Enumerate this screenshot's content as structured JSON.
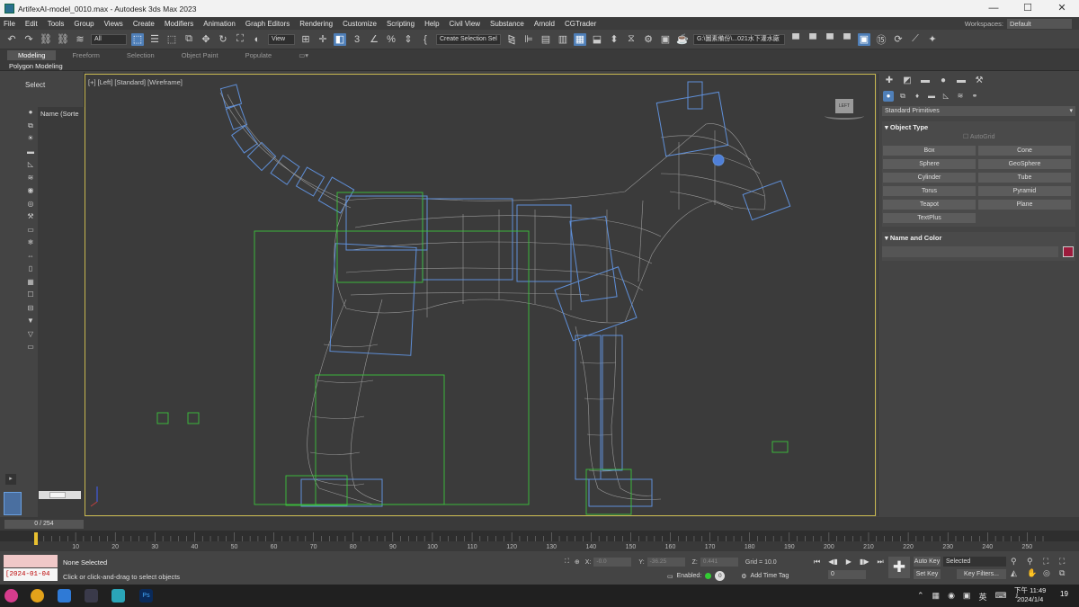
{
  "window": {
    "title": "ArtifexAI-model_0010.max - Autodesk 3ds Max 2023",
    "minimize": "—",
    "maximize": "☐",
    "close": "✕"
  },
  "menu": [
    "File",
    "Edit",
    "Tools",
    "Group",
    "Views",
    "Create",
    "Modifiers",
    "Animation",
    "Graph Editors",
    "Rendering",
    "Customize",
    "Scripting",
    "Help",
    "Civil View",
    "Substance",
    "Arnold",
    "CGTrader"
  ],
  "workspaces": {
    "label": "Workspaces:",
    "value": "Default"
  },
  "toolbar": {
    "filter": "All",
    "refcoord": "View",
    "selset": "Create Selection Sel",
    "path": "G:\\圖素備份\\...021水下灌水廠"
  },
  "ribbon": {
    "tabs": [
      "Modeling",
      "Freeform",
      "Selection",
      "Object Paint",
      "Populate"
    ],
    "subtab": "Polygon Modeling"
  },
  "explorer": {
    "title": "Select",
    "column": "Name (Sorte"
  },
  "viewport": {
    "label": "[+] [Left] [Standard] [Wireframe]",
    "cube": "LEFT"
  },
  "command_panel": {
    "category": "Standard Primitives",
    "object_type": "Object Type",
    "autogrid": "AutoGrid",
    "buttons": [
      "Box",
      "Cone",
      "Sphere",
      "GeoSphere",
      "Cylinder",
      "Tube",
      "Torus",
      "Pyramid",
      "Teapot",
      "Plane",
      "TextPlus"
    ],
    "name_and_color": "Name and Color",
    "color": "#9c1b3c"
  },
  "timeline": {
    "frame": "0 / 254",
    "ticks": [
      "0",
      "10",
      "20",
      "30",
      "40",
      "50",
      "60",
      "70",
      "80",
      "90",
      "100",
      "110",
      "120",
      "130",
      "140",
      "150",
      "160",
      "170",
      "180",
      "190",
      "200",
      "210",
      "220",
      "230",
      "240",
      "250"
    ]
  },
  "status": {
    "date": "[2024-01-04",
    "line1": "None Selected",
    "line2": "Click or click-and-drag to select objects",
    "x_label": "X:",
    "x_value": "-0.0",
    "y_label": "Y:",
    "y_value": "-36.25",
    "z_label": "Z:",
    "z_value": "0.441",
    "grid": "Grid = 10.0",
    "enabled": "Enabled:",
    "enabled_value": "0",
    "add_time_tag": "Add Time Tag",
    "frame_input": "0",
    "auto_key": "Auto Key",
    "set_key": "Set Key",
    "selected": "Selected",
    "key_filters": "Key Filters..."
  },
  "taskbar": {
    "time": "下午 11:49",
    "date": "2024/1/4",
    "ime": "英",
    "notifications": "19"
  }
}
